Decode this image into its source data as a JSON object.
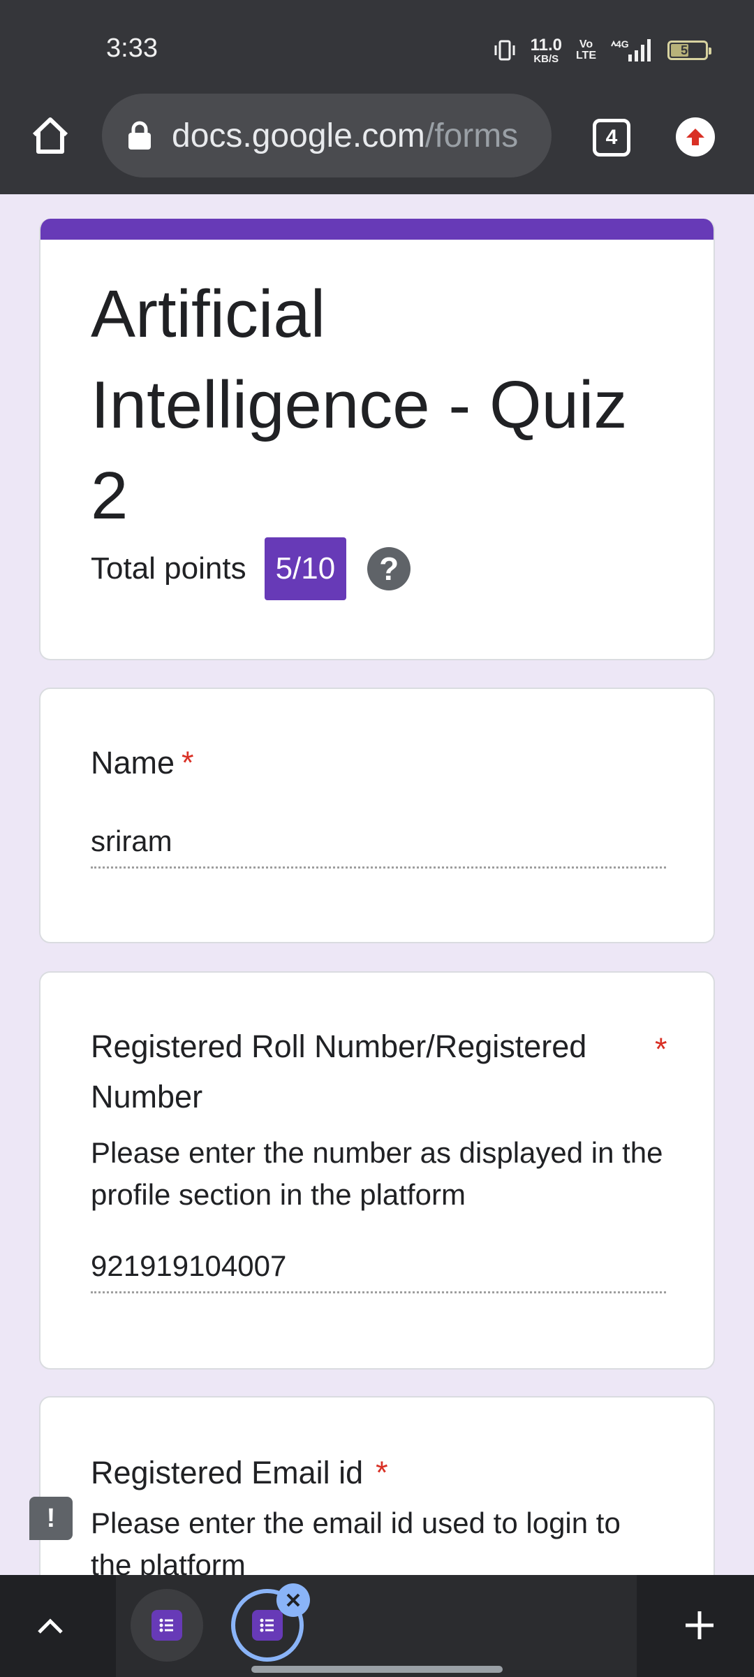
{
  "status_bar": {
    "time": "3:33",
    "net_speed_value": "11.0",
    "net_speed_unit": "KB/S",
    "volte_top": "Vo",
    "volte_bottom": "LTE",
    "network_type": "4G",
    "battery_level": "56",
    "battery_fraction": 0.56
  },
  "browser": {
    "url_domain": "docs.google.com",
    "url_path": "/forms",
    "tab_count": "4"
  },
  "form": {
    "title": "Artificial Intelligence - Quiz 2",
    "points_label": "Total points",
    "score": "5/10",
    "help_glyph": "?",
    "accent_color": "#673ab7"
  },
  "questions": {
    "name": {
      "title": "Name",
      "required_mark": "*",
      "answer": "sriram"
    },
    "roll": {
      "title": "Registered Roll Number/Registered Number",
      "required_mark": "*",
      "description": "Please enter the number as displayed in the profile section in the platform",
      "answer": "921919104007"
    },
    "email": {
      "title": "Registered Email id",
      "required_mark": "*",
      "description": "Please enter the email id used to login to the platform"
    }
  },
  "feedback_glyph": "!",
  "icons": {
    "home": "home-icon",
    "lock": "lock-icon",
    "tabs": "tab-switcher-icon",
    "update": "update-icon",
    "chevron": "chevron-up-icon",
    "forms": "google-forms-icon",
    "close": "close-icon",
    "add": "plus-icon"
  }
}
